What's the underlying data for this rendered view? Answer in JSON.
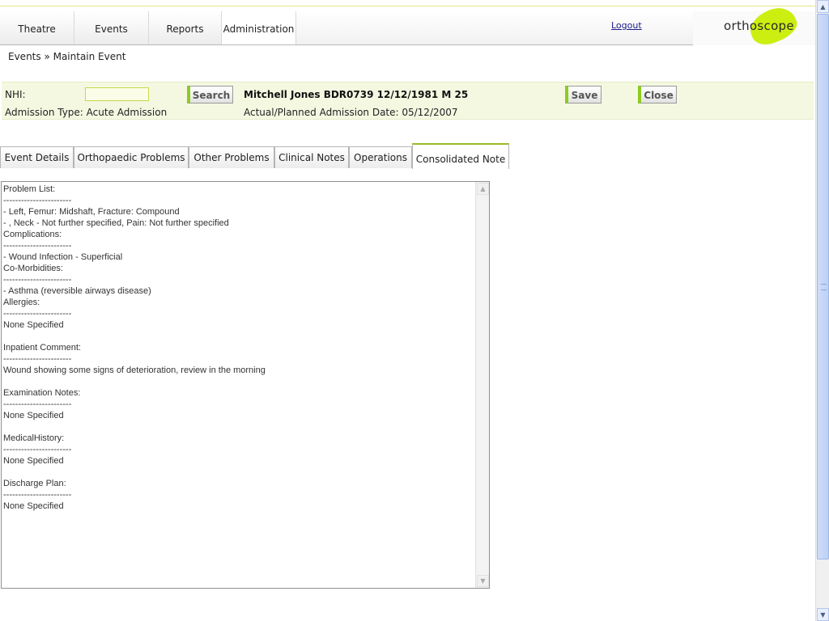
{
  "nav": {
    "tabs": [
      "Theatre",
      "Events",
      "Reports",
      "Administration"
    ],
    "logout": "Logout",
    "logo": "orthoscope"
  },
  "breadcrumb": "Events » Maintain Event",
  "patient": {
    "nhi_label": "NHI:",
    "nhi_value": "",
    "search_label": "Search",
    "name_line": "Mitchell Jones BDR0739 12/12/1981 M 25",
    "save_label": "Save",
    "close_label": "Close",
    "admission_type": "Admission Type: Acute Admission",
    "admission_date": "Actual/Planned Admission Date: 05/12/2007"
  },
  "tabs": [
    "Event Details",
    "Orthopaedic Problems",
    "Other Problems",
    "Clinical Notes",
    "Operations",
    "Consolidated Note"
  ],
  "active_tab": "Consolidated Note",
  "note": "Problem List:\n-----------------------\n- Left, Femur: Midshaft, Fracture: Compound\n- , Neck - Not further specified, Pain: Not further specified\nComplications:\n-----------------------\n- Wound Infection - Superficial\nCo-Morbidities:\n-----------------------\n- Asthma (reversible airways disease)\nAllergies:\n-----------------------\nNone Specified\n\nInpatient Comment:\n-----------------------\nWound showing some signs of deterioration, review in the morning\n\nExamination Notes:\n-----------------------\nNone Specified\n\nMedicalHistory:\n-----------------------\nNone Specified\n\nDischarge Plan:\n-----------------------\nNone Specified"
}
